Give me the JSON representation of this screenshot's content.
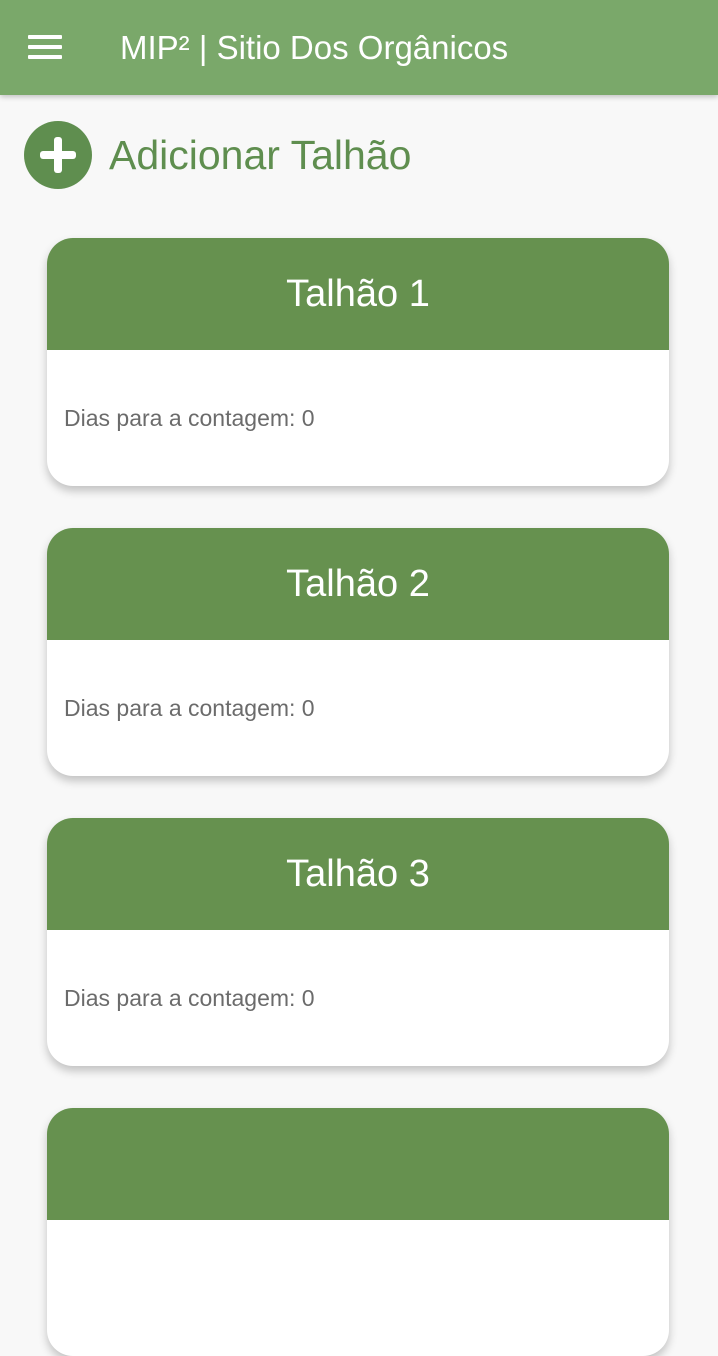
{
  "app_bar": {
    "title": "MIP² | Sitio Dos Orgânicos",
    "menu_icon": "hamburger-menu-icon",
    "background_color": "#7aa86a"
  },
  "add_plot": {
    "label": "Adicionar Talhão",
    "icon": "add-circle-icon",
    "color": "#5f8e4f"
  },
  "plots": [
    {
      "title": "Talhão 1",
      "info": "Dias para a contagem: 0"
    },
    {
      "title": "Talhão 2",
      "info": "Dias para a contagem: 0"
    },
    {
      "title": "Talhão 3",
      "info": "Dias para a contagem: 0"
    },
    {
      "title": "",
      "info": ""
    }
  ],
  "card_header_color": "#66914f"
}
